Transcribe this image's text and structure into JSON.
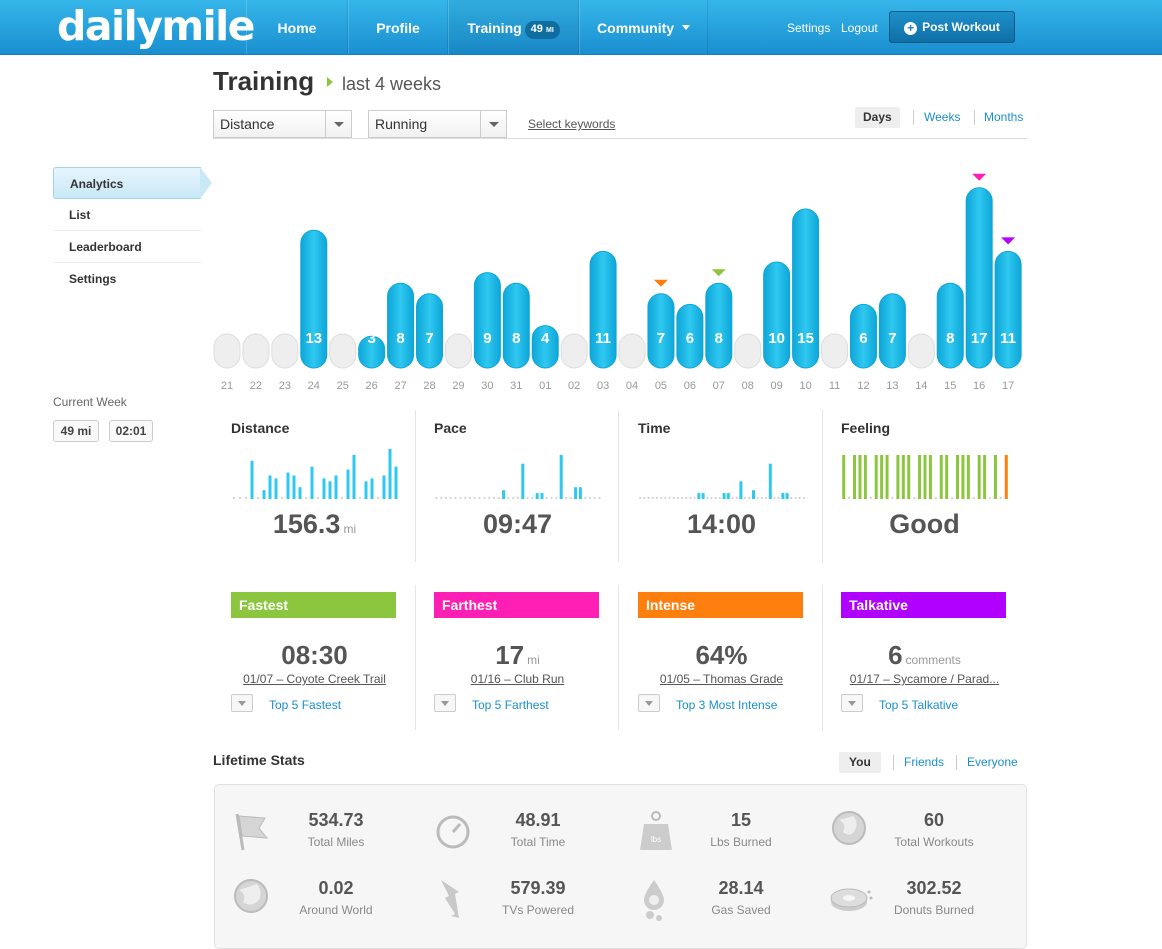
{
  "header": {
    "logo": "dailymile",
    "nav": [
      {
        "label": "Home"
      },
      {
        "label": "Profile"
      },
      {
        "label": "Training",
        "badge": "49",
        "badge_unit": "MI"
      },
      {
        "label": "Community"
      }
    ],
    "settings": "Settings",
    "logout": "Logout",
    "post_workout": "Post Workout"
  },
  "sidebar": {
    "items": [
      {
        "label": "Analytics",
        "active": true
      },
      {
        "label": "List"
      },
      {
        "label": "Leaderboard"
      },
      {
        "label": "Settings"
      }
    ],
    "current_week_label": "Current Week",
    "current_week_distance": "49 mi",
    "current_week_time": "02:01"
  },
  "page": {
    "title": "Training",
    "subtitle": "last 4 weeks",
    "metric_select": "Distance",
    "activity_select": "Running",
    "keywords_link": "Select keywords",
    "ranges": [
      "Days",
      "Weeks",
      "Months"
    ],
    "selected_range": "Days"
  },
  "colors": {
    "bar": "#2ec8f0",
    "bar_dark": "#0ea6d8",
    "empty_bar": "#eeeeee",
    "fastest": "#8cc63f",
    "farthest": "#ff1fb4",
    "intense": "#ff7f0e",
    "talkative": "#b000ff",
    "brand": "#1a9ad6"
  },
  "chart_data": {
    "type": "bar",
    "categories": [
      "21",
      "22",
      "23",
      "24",
      "25",
      "26",
      "27",
      "28",
      "29",
      "30",
      "31",
      "01",
      "02",
      "03",
      "04",
      "05",
      "06",
      "07",
      "08",
      "09",
      "10",
      "11",
      "12",
      "13",
      "14",
      "15",
      "16",
      "17"
    ],
    "values": [
      0,
      0,
      0,
      13,
      0,
      3,
      8,
      7,
      0,
      9,
      8,
      4,
      0,
      11,
      0,
      7,
      6,
      8,
      0,
      10,
      15,
      0,
      6,
      7,
      0,
      8,
      17,
      11
    ],
    "ylim": [
      0,
      18
    ],
    "markers": [
      {
        "index": 15,
        "record": "intense"
      },
      {
        "index": 17,
        "record": "fastest"
      },
      {
        "index": 26,
        "record": "farthest"
      },
      {
        "index": 27,
        "record": "talkative"
      }
    ]
  },
  "stats": [
    {
      "title": "Distance",
      "value": "156.3",
      "unit": "mi",
      "spark": [
        0,
        0,
        0,
        13,
        0,
        3,
        8,
        7,
        0,
        9,
        8,
        4,
        0,
        11,
        0,
        7,
        6,
        8,
        0,
        10,
        15,
        0,
        6,
        7,
        0,
        8,
        17,
        11
      ],
      "spark_max": 17,
      "kind": "bar"
    },
    {
      "title": "Pace",
      "value": "09:47",
      "unit": "",
      "spark": [
        0,
        0,
        0,
        0,
        0,
        0,
        0,
        0,
        0,
        0,
        0,
        0,
        0,
        0,
        3,
        0,
        0,
        0,
        12,
        0,
        0,
        2,
        2,
        0,
        0,
        0,
        15,
        0,
        0,
        4,
        4,
        0,
        0,
        0,
        0
      ],
      "spark_max": 17,
      "kind": "bar"
    },
    {
      "title": "Time",
      "value": "14:00",
      "unit": "",
      "spark": [
        0,
        0,
        0,
        0,
        0,
        0,
        0,
        0,
        0,
        0,
        0,
        0,
        0,
        0,
        2,
        2,
        0,
        0,
        0,
        0,
        2,
        2,
        0,
        0,
        6,
        0,
        0,
        3,
        0,
        0,
        0,
        12,
        0,
        0,
        2,
        2,
        0,
        0,
        0,
        0
      ],
      "spark_max": 17,
      "kind": "bar"
    },
    {
      "title": "Feeling",
      "value": "Good",
      "unit": "",
      "spark": [
        1,
        0,
        1,
        1,
        1,
        0,
        1,
        1,
        1,
        0,
        1,
        1,
        1,
        0,
        1,
        1,
        1,
        0,
        1,
        1,
        0,
        1,
        1,
        1,
        0,
        1,
        1,
        0,
        1,
        0,
        1
      ],
      "spark_max": 1,
      "kind": "feeling"
    }
  ],
  "records": [
    {
      "label": "Fastest",
      "value": "08:30",
      "unit": "",
      "sub": "01/07 – Coyote Creek Trail",
      "link": "Top 5 Fastest",
      "color": "#8cc63f"
    },
    {
      "label": "Farthest",
      "value": "17",
      "unit": "mi",
      "sub": "01/16 – Club Run",
      "link": "Top 5 Farthest",
      "color": "#ff1fb4"
    },
    {
      "label": "Intense",
      "value": "64%",
      "unit": "",
      "sub": "01/05 – Thomas Grade",
      "link": "Top 3 Most Intense",
      "color": "#ff7f0e"
    },
    {
      "label": "Talkative",
      "value": "6",
      "unit": "comments",
      "sub": "01/17 – Sycamore / Parad...",
      "link": "Top 5 Talkative",
      "color": "#b000ff"
    }
  ],
  "lifetime": {
    "title": "Lifetime Stats",
    "tabs": [
      "You",
      "Friends",
      "Everyone"
    ],
    "selected_tab": "You",
    "items": [
      {
        "value": "534.73",
        "label": "Total Miles",
        "icon": "flag-icon"
      },
      {
        "value": "48.91",
        "label": "Total Time",
        "icon": "clock-icon"
      },
      {
        "value": "15",
        "label": "Lbs Burned",
        "icon": "weight-icon"
      },
      {
        "value": "60",
        "label": "Total Workouts",
        "icon": "globe-icon"
      },
      {
        "value": "0.02",
        "label": "Around World",
        "icon": "world-icon"
      },
      {
        "value": "579.39",
        "label": "TVs Powered",
        "icon": "lightning-icon"
      },
      {
        "value": "28.14",
        "label": "Gas Saved",
        "icon": "gas-drop-icon"
      },
      {
        "value": "302.52",
        "label": "Donuts Burned",
        "icon": "donut-icon"
      }
    ],
    "icon_labels": {
      "weight": "lbs"
    }
  }
}
